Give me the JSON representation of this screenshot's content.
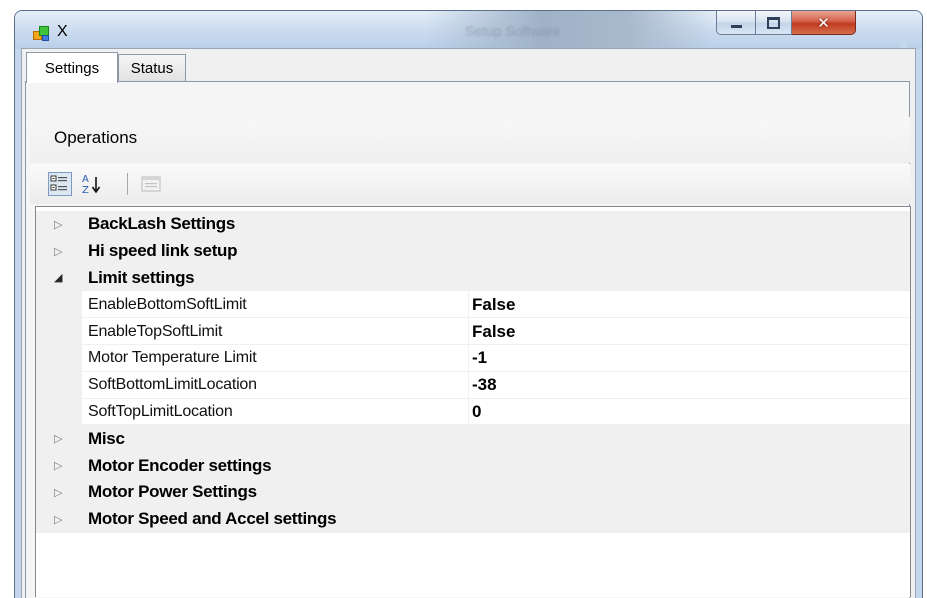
{
  "window": {
    "title": "X",
    "faint_title": "Setup Software"
  },
  "tabs": [
    {
      "label": "Settings",
      "active": true
    },
    {
      "label": "Status",
      "active": false
    }
  ],
  "section": {
    "label": "Operations"
  },
  "toolbar": {
    "categorized_icon": "categorized-icon",
    "alphabetical_icon": "alphabetical-sort-icon",
    "property_pages_icon": "property-pages-icon"
  },
  "grid": {
    "rows": [
      {
        "kind": "category",
        "expanded": false,
        "label": "BackLash Settings"
      },
      {
        "kind": "category",
        "expanded": false,
        "label": "Hi speed link setup"
      },
      {
        "kind": "category",
        "expanded": true,
        "label": "Limit settings"
      },
      {
        "kind": "property",
        "name": "EnableBottomSoftLimit",
        "value": "False"
      },
      {
        "kind": "property",
        "name": "EnableTopSoftLimit",
        "value": "False"
      },
      {
        "kind": "property",
        "name": "Motor Temperature Limit",
        "value": "-1"
      },
      {
        "kind": "property",
        "name": "SoftBottomLimitLocation",
        "value": "-38"
      },
      {
        "kind": "property",
        "name": "SoftTopLimitLocation",
        "value": "0"
      },
      {
        "kind": "category",
        "expanded": false,
        "label": "Misc"
      },
      {
        "kind": "category",
        "expanded": false,
        "label": "Motor Encoder settings"
      },
      {
        "kind": "category",
        "expanded": false,
        "label": "Motor Power Settings"
      },
      {
        "kind": "category",
        "expanded": false,
        "label": "Motor Speed and Accel settings"
      }
    ]
  },
  "colors": {
    "titlebar": "#c4d7ec",
    "close_button": "#c8452a",
    "grid_margin": "#f0f0f0"
  }
}
